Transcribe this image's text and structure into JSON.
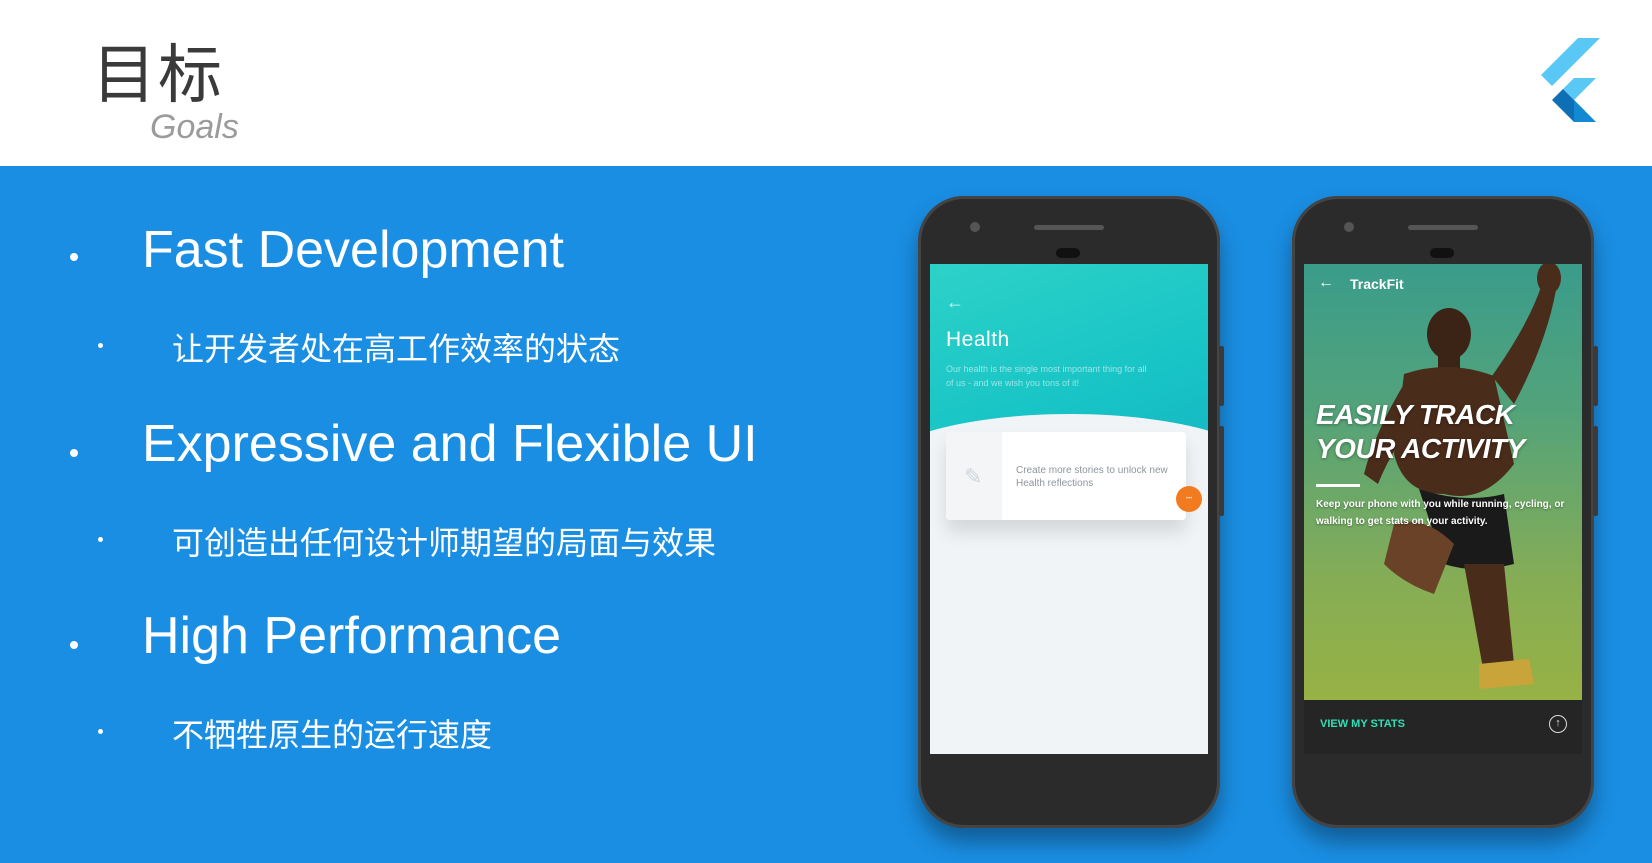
{
  "header": {
    "title": "目标",
    "subtitle": "Goals",
    "logo_icon": "flutter-logo"
  },
  "colors": {
    "main_bg": "#1a8ee3",
    "teal": "#18c4c6",
    "accent_green": "#2fe0b5",
    "fab_orange": "#f27b1f"
  },
  "bullets": [
    {
      "title": "Fast Development",
      "sub": "让开发者处在高工作效率的状态"
    },
    {
      "title": "Expressive and Flexible UI",
      "sub": "可创造出任何设计师期望的局面与效果"
    },
    {
      "title": "High Performance",
      "sub": "不牺牲原生的运行速度"
    }
  ],
  "phone_health": {
    "back_icon": "arrow-left-icon",
    "title": "Health",
    "description": "Our health is the single most important thing for all of us - and we wish you tons of it!",
    "card_text": "Create more stories to unlock new Health reflections",
    "card_icon": "pen-icon"
  },
  "phone_trackfit": {
    "back_icon": "arrow-left-icon",
    "title": "TrackFit",
    "headline_line1": "EASILY TRACK",
    "headline_line2": "YOUR ACTIVITY",
    "description": "Keep your phone with you while running, cycling, or walking to get stats on your activity.",
    "cta": "VIEW MY STATS",
    "upload_icon": "upload-icon"
  }
}
